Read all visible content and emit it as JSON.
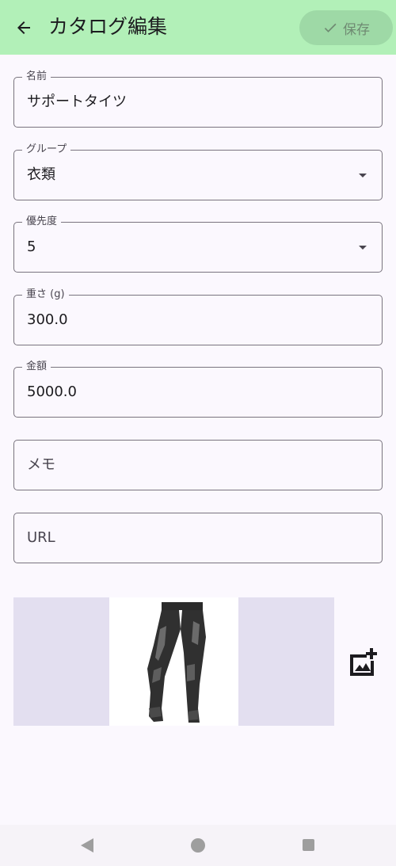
{
  "app_bar": {
    "title": "カタログ編集",
    "save_label": "保存",
    "back_icon": "arrow-left-icon",
    "save_icon": "check-icon"
  },
  "form": {
    "name": {
      "label": "名前",
      "value": "サポートタイツ"
    },
    "group": {
      "label": "グループ",
      "value": "衣類"
    },
    "priority": {
      "label": "優先度",
      "value": "5"
    },
    "weight": {
      "label": "重さ (g)",
      "value": "300.0"
    },
    "price": {
      "label": "金額",
      "value": "5000.0"
    },
    "memo": {
      "placeholder": "メモ"
    },
    "url": {
      "placeholder": "URL"
    }
  },
  "image": {
    "subject": "black support tights",
    "add_icon": "add-photo-icon"
  },
  "system_nav": {
    "back_icon": "nav-back-icon",
    "home_icon": "nav-home-icon",
    "recents_icon": "nav-recents-icon"
  },
  "colors": {
    "top_bar": "#b2f0b8",
    "save_button": "#9ed9a6",
    "background": "#fbf8fe",
    "outline": "#79747e",
    "image_placeholder": "#e3dff0"
  }
}
